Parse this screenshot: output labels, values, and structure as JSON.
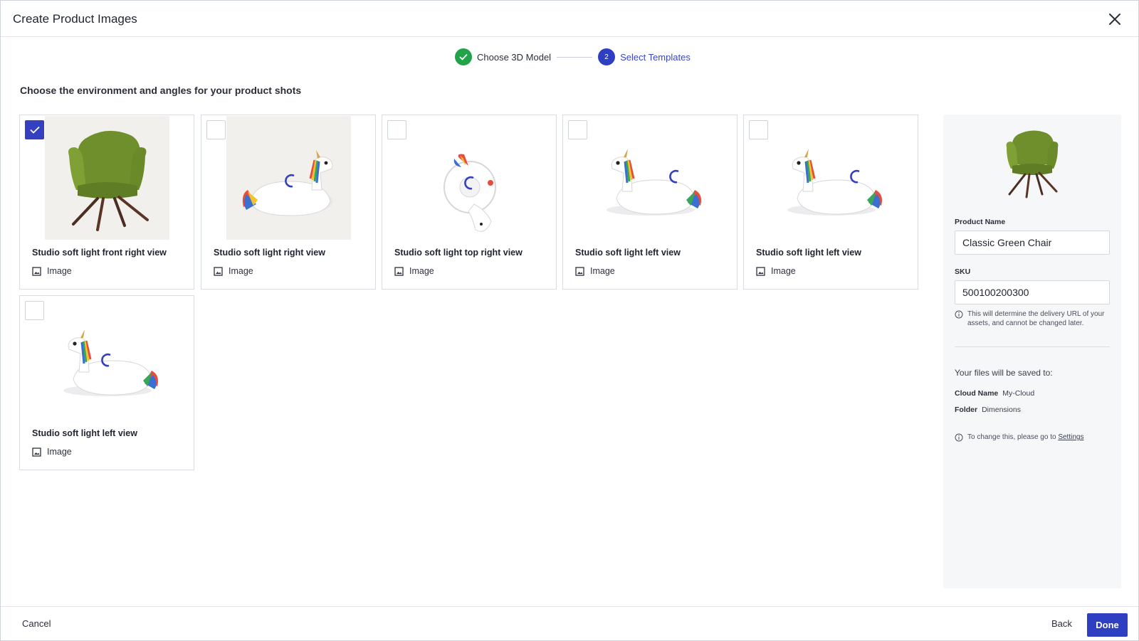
{
  "dialog": {
    "title": "Create Product Images"
  },
  "stepper": {
    "steps": [
      {
        "number": "1",
        "label": "Choose 3D Model",
        "state": "complete"
      },
      {
        "number": "2",
        "label": "Select Templates",
        "state": "active"
      }
    ]
  },
  "intro": "Choose the environment and angles for your product shots",
  "templates": [
    {
      "name": "Studio soft light front right view",
      "type": "Image",
      "checked": true,
      "image": "green-chair",
      "loading": false
    },
    {
      "name": "Studio soft light right view",
      "type": "Image",
      "checked": false,
      "image": "unicorn-float-right",
      "loading": true
    },
    {
      "name": "Studio soft light top right view",
      "type": "Image",
      "checked": false,
      "image": "unicorn-float-top",
      "loading": true
    },
    {
      "name": "Studio soft light left view",
      "type": "Image",
      "checked": false,
      "image": "unicorn-float-left",
      "loading": true
    },
    {
      "name": "Studio soft light left view",
      "type": "Image",
      "checked": false,
      "image": "unicorn-float-left",
      "loading": true
    },
    {
      "name": "Studio soft light left view",
      "type": "Image",
      "checked": false,
      "image": "unicorn-float-left",
      "loading": true
    }
  ],
  "side": {
    "product_name_label": "Product Name",
    "product_name_value": "Classic Green Chair",
    "sku_label": "SKU",
    "sku_value": "500100200300",
    "sku_hint": "This will determine the delivery URL of your assets, and cannot be changed later.",
    "saved_to": "Your files will be saved to:",
    "cloud_name_label": "Cloud Name",
    "cloud_name_value": "My-Cloud",
    "folder_label": "Folder",
    "folder_value": "Dimensions",
    "change_hint": "To change this, please go to",
    "settings_link": "Settings"
  },
  "footer": {
    "cancel": "Cancel",
    "back": "Back",
    "done": "Done"
  },
  "colors": {
    "primary": "#2f3fc1",
    "success": "#22a34a",
    "chair": "#6f8f2d"
  }
}
